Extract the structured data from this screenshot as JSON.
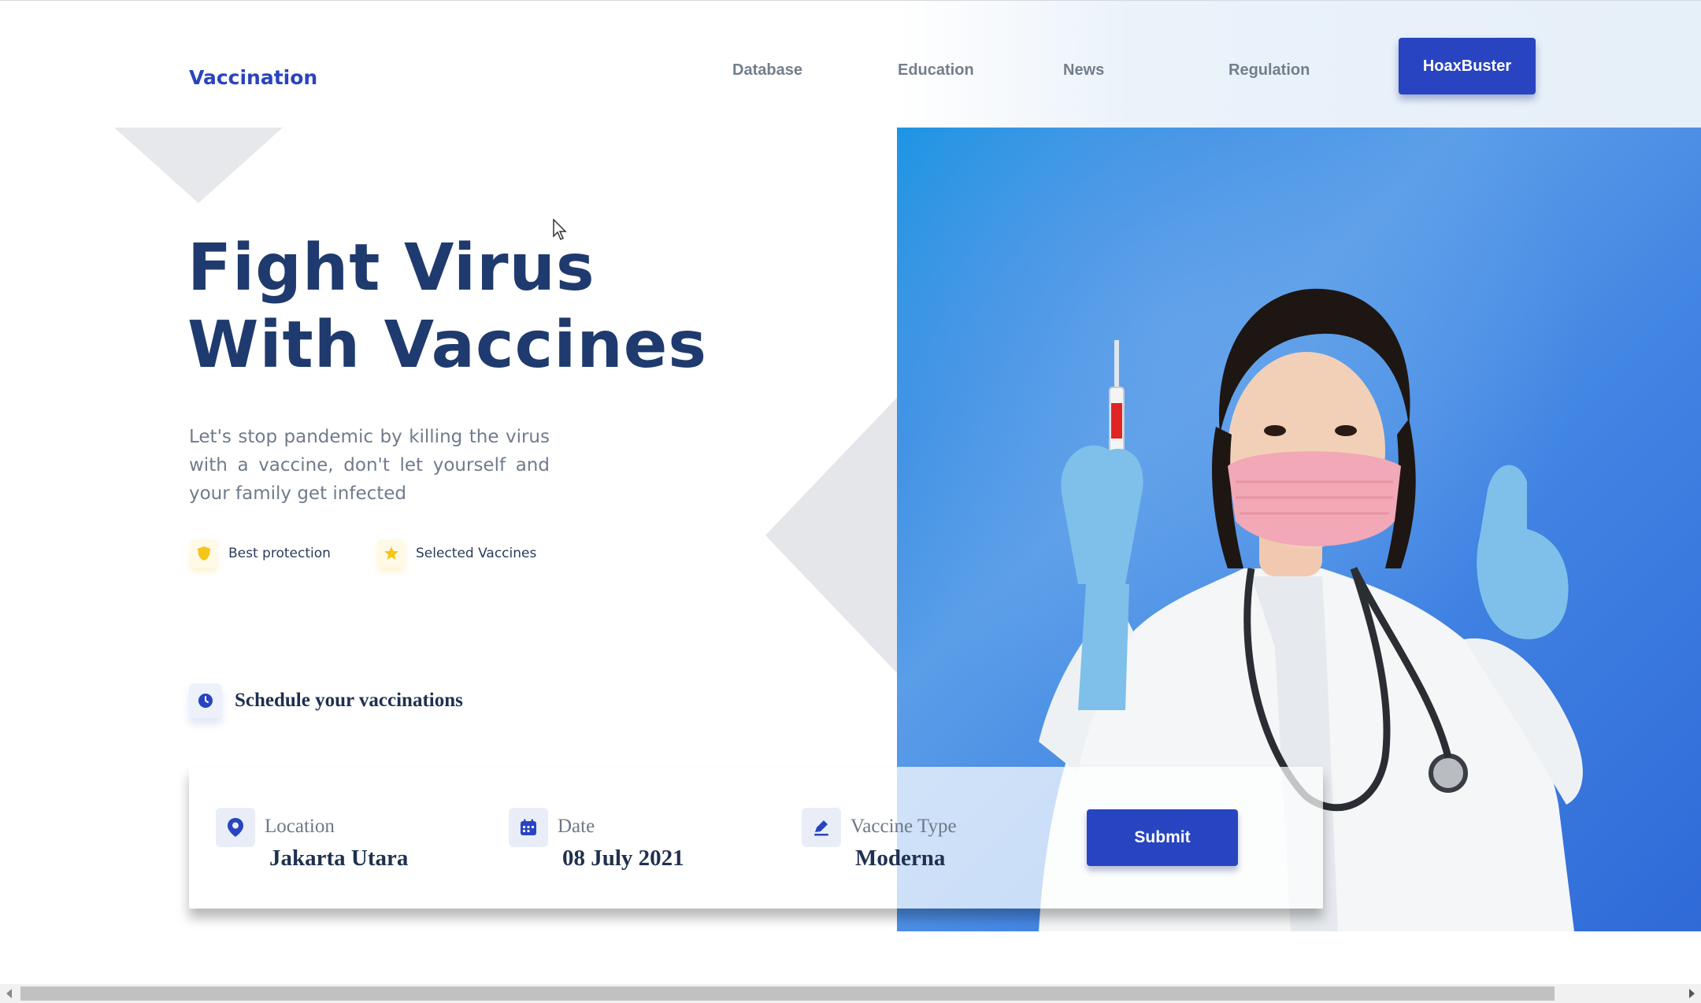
{
  "header": {
    "logo": "Vaccination",
    "nav": [
      "Database",
      "Education",
      "News",
      "Regulation"
    ],
    "cta": "HoaxBuster"
  },
  "hero": {
    "title_line1": "Fight Virus",
    "title_line2": "With Vaccines",
    "subtitle": "Let's stop pandemic by killing the virus with a vaccine, don't let yourself and your family get infected",
    "badges": [
      {
        "label": "Best protection",
        "icon": "shield-icon"
      },
      {
        "label": "Selected Vaccines",
        "icon": "star-icon"
      }
    ]
  },
  "schedule": {
    "label": "Schedule your vaccinations",
    "icon": "clock-icon"
  },
  "form": {
    "fields": [
      {
        "label": "Location",
        "value": "Jakarta Utara",
        "icon": "map-pin-icon"
      },
      {
        "label": "Date",
        "value": "08 July 2021",
        "icon": "calendar-icon"
      },
      {
        "label": "Vaccine Type",
        "value": "Moderna",
        "icon": "pen-icon"
      }
    ],
    "submit": "Submit"
  },
  "colors": {
    "brand": "#2844c0",
    "heading": "#1f3a6e",
    "hero_blue": "#3a8fe3",
    "badge_yellow": "#f5c518"
  }
}
